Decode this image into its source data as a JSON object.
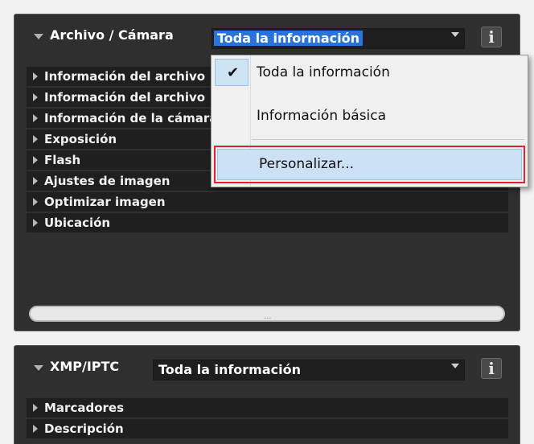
{
  "panel_top": {
    "title": "Archivo / Cámara",
    "combo_value": "Toda la información",
    "info_icon": "i",
    "rows": [
      "Información del archivo",
      "Información del archivo",
      "Información de la cámara",
      "Exposición",
      "Flash",
      "Ajustes de imagen",
      "Optimizar imagen",
      "Ubicación"
    ],
    "scroll_grip": "....."
  },
  "dropdown": {
    "check_glyph": "✔",
    "items": [
      "Toda la información",
      "Información básica",
      "Personalizar..."
    ],
    "selected_index": 0,
    "highlighted_index": 2
  },
  "panel_bottom": {
    "title": "XMP/IPTC",
    "combo_value": "Toda la información",
    "info_icon": "i",
    "rows": [
      "Marcadores",
      "Descripción"
    ]
  },
  "colors": {
    "panel_bg": "#2f2f2f",
    "row_bg": "#1f1f1f",
    "selection_blue": "#2a74d9",
    "highlight_red": "#e0202a",
    "menu_highlight": "#cde1f6"
  },
  "icons": [
    "collapse-triangle-icon",
    "expand-triangle-icon",
    "dropdown-arrow-icon",
    "info-icon",
    "checkmark-icon"
  ]
}
